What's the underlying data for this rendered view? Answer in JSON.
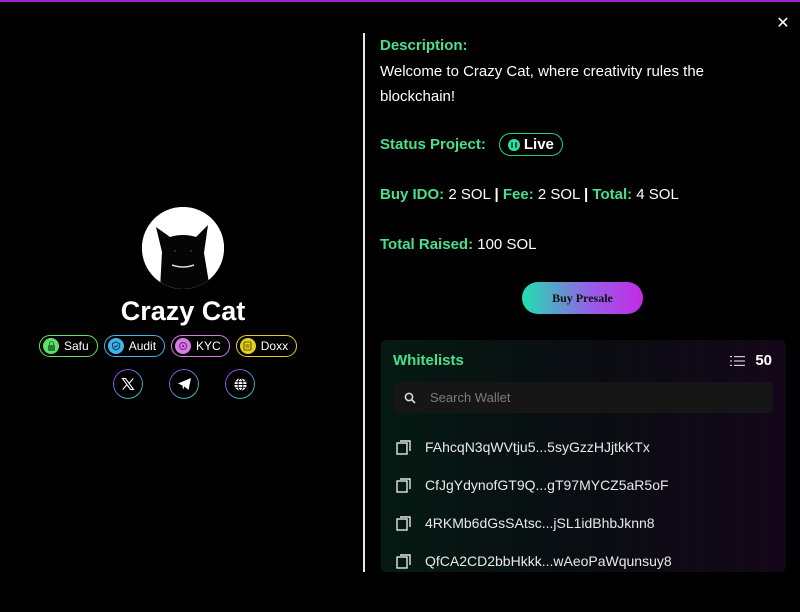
{
  "window": {
    "close_label": "✕"
  },
  "project": {
    "name": "Crazy Cat",
    "avatar_alt": "Crazy Cat logo"
  },
  "badges": [
    {
      "label": "Safu",
      "icon": "safu-icon",
      "color": "#5ee36a"
    },
    {
      "label": "Audit",
      "icon": "audit-icon",
      "color": "#3fb6e8"
    },
    {
      "label": "KYC",
      "icon": "kyc-icon",
      "color": "#d97be8"
    },
    {
      "label": "Doxx",
      "icon": "doxx-icon",
      "color": "#e6d01c"
    }
  ],
  "socials": [
    {
      "name": "x-twitter",
      "icon": "x-icon"
    },
    {
      "name": "telegram",
      "icon": "telegram-icon"
    },
    {
      "name": "website",
      "icon": "globe-icon"
    }
  ],
  "details": {
    "description_label": "Description:",
    "description_text": "Welcome to Crazy Cat, where creativity rules the blockchain!",
    "status_label": "Status Project:",
    "status_value": "Live",
    "buy_ido_label": "Buy IDO:",
    "buy_ido_value": " 2 SOL ",
    "fee_label": "Fee:",
    "fee_value": " 2 SOL ",
    "total_label": "Total:",
    "total_value": " 4 SOL",
    "separator": "|",
    "total_raised_label": "Total Raised:",
    "total_raised_value": " 100 SOL",
    "buy_presale_button": "Buy Presale"
  },
  "whitelist": {
    "title": "Whitelists",
    "count": "50",
    "search_placeholder": "Search Wallet",
    "search_value": "",
    "items": [
      "FAhcqN3qWVtju5...5syGzzHJjtkKTx",
      "CfJgYdynofGT9Q...gT97MYCZ5aR5oF",
      "4RKMb6dGsSAtsc...jSL1idBhbJknn8",
      "QfCA2CD2bbHkkk...wAeoPaWqunsuy8"
    ]
  },
  "colors": {
    "accent_green": "#49e08c",
    "top_bar": "#a21fd1",
    "live_border": "#27c98e"
  }
}
